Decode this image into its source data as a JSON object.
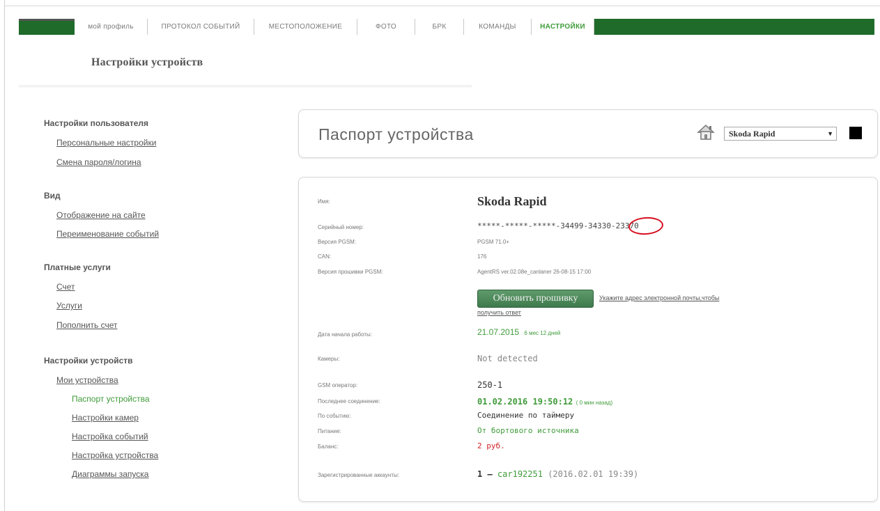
{
  "nav": {
    "tabs": [
      {
        "label": "мой профиль",
        "active": false
      },
      {
        "label": "ПРОТОКОЛ СОБЫТИЙ",
        "active": false
      },
      {
        "label": "МЕСТОПОЛОЖЕНИЕ",
        "active": false
      },
      {
        "label": "ФОТО",
        "active": false
      },
      {
        "label": "БРК",
        "active": false
      },
      {
        "label": "КОМАНДЫ",
        "active": false
      },
      {
        "label": "НАСТРОЙКИ",
        "active": true
      }
    ]
  },
  "page": {
    "title": "Настройки устройств"
  },
  "sidebar": {
    "sections": [
      {
        "title": "Настройки пользователя",
        "links": [
          "Персональные настройки",
          "Смена пароля/логина"
        ]
      },
      {
        "title": "Вид",
        "links": [
          "Отображение на сайте",
          "Переименование событий"
        ]
      },
      {
        "title": "Платные услуги",
        "links": [
          "Счет",
          "Услуги",
          "Пополнить счет"
        ]
      },
      {
        "title": "Настройки устройств",
        "links": [
          "Мои устройства"
        ],
        "sublinks": [
          "Паспорт устройства",
          "Настройки камер",
          "Настройка событий",
          "Настройка устройства",
          "Диаграммы запуска"
        ]
      }
    ]
  },
  "passport": {
    "title": "Паспорт устройства",
    "selected_device": "Skoda Rapid",
    "labels": {
      "name": "Имя:",
      "serial": "Серийный номер:",
      "pgsm_version": "Версия PGSM:",
      "can": "CAN:",
      "firmware": "Версия прошивки PGSM:",
      "start_date": "Дата начала работы:",
      "cameras": "Камеры:",
      "gsm": "GSM оператор:",
      "last_conn": "Последнее соединение:",
      "by_event": "По событию:",
      "power": "Питание:",
      "balance": "Баланс:",
      "accounts": "Зарегистрированные аккаунты:"
    },
    "values": {
      "name": "Skoda Rapid",
      "serial": "*****-*****-*****-34499-34330-23370",
      "pgsm_version": "PGSM 71.0+",
      "can": "176",
      "firmware": "AgentRS ver.02.08e_canlaner 26-08-15 17:00",
      "update_button": "Обновить прошивку",
      "email_link_1": "Укажите адрес электронной почты,чтобы",
      "email_link_2": "получить ответ",
      "start_date": "21.07.2015",
      "start_date_ago": "6 мес 12 дней",
      "cameras": "Not detected",
      "gsm": "250-1",
      "last_conn": "01.02.2016 19:50:12",
      "last_conn_ago": "( 0 мин назад)",
      "by_event": "Соединение по таймеру",
      "power": "От бортового источника",
      "balance": "2 руб.",
      "accounts_num": "1 —",
      "accounts_user": "car192251",
      "accounts_date": "(2016.02.01 19:39)"
    }
  },
  "colors": {
    "nav_green": "#1f6b2a",
    "accent_green": "#3f9b3a",
    "balance_red": "#d2232a",
    "annotation_red": "#d61020"
  }
}
